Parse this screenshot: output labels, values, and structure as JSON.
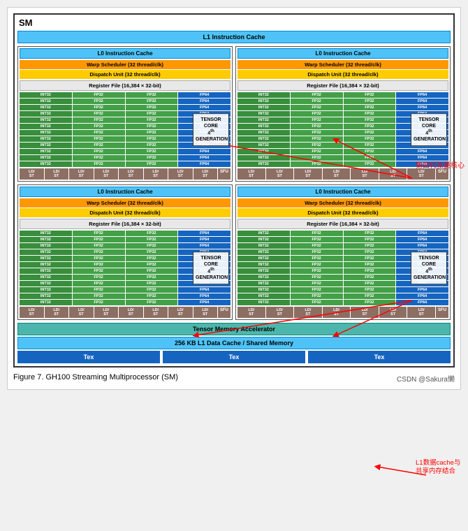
{
  "sm_title": "SM",
  "l1_instruction_cache": "L1 Instruction Cache",
  "quadrants": [
    {
      "l0": "L0 Instruction Cache",
      "warp": "Warp Scheduler (32 thread/clk)",
      "dispatch": "Dispatch Unit (32 thread/clk)",
      "register": "Register File (16,384 × 32-bit)",
      "tensor_label": "TENSOR CORE\n4th GENERATION"
    },
    {
      "l0": "L0 Instruction Cache",
      "warp": "Warp Scheduler (32 thread/clk)",
      "dispatch": "Dispatch Unit (32 thread/clk)",
      "register": "Register File (16,384 × 32-bit)",
      "tensor_label": "TENSOR CORE\n4th GENERATION"
    },
    {
      "l0": "L0 Instruction Cache",
      "warp": "Warp Scheduler (32 thread/clk)",
      "dispatch": "Dispatch Unit (32 thread/clk)",
      "register": "Register File (16,384 × 32-bit)",
      "tensor_label": "TENSOR CORE\n4th GENERATION"
    },
    {
      "l0": "L0 Instruction Cache",
      "warp": "Warp Scheduler (32 thread/clk)",
      "dispatch": "Dispatch Unit (32 thread/clk)",
      "register": "Register File (16,384 × 32-bit)",
      "tensor_label": "TENSOR CORE\n4th GENERATION"
    }
  ],
  "core_rows": [
    {
      "int32": "INT32",
      "fp32a": "FP32",
      "fp32b": "FP32",
      "fp64": "FP64"
    },
    {
      "int32": "INT32",
      "fp32a": "FP32",
      "fp32b": "FP32",
      "fp64": "FP64"
    },
    {
      "int32": "INT32",
      "fp32a": "FP32",
      "fp32b": "FP32",
      "fp64": "FP64"
    },
    {
      "int32": "INT32",
      "fp32a": "FP32",
      "fp32b": "FP32",
      "fp64": "FP64"
    },
    {
      "int32": "INT32",
      "fp32a": "FP32",
      "fp32b": "FP32",
      "fp64": "FP64"
    },
    {
      "int32": "INT32",
      "fp32a": "FP32",
      "fp32b": "FP32",
      "fp64": "FP64"
    },
    {
      "int32": "INT32",
      "fp32a": "FP32",
      "fp32b": "FP32",
      "fp64": "FP64"
    },
    {
      "int32": "INT32",
      "fp32a": "FP32",
      "fp32b": "FP32",
      "fp64": "FP64"
    },
    {
      "int32": "INT32",
      "fp32a": "FP32",
      "fp32b": "FP32",
      "fp64": "FP64"
    },
    {
      "int32": "INT32",
      "fp32a": "FP32",
      "fp32b": "FP32",
      "fp64": "FP64"
    },
    {
      "int32": "INT32",
      "fp32a": "FP32",
      "fp32b": "FP32",
      "fp64": "FP64"
    },
    {
      "int32": "INT32",
      "fp32a": "FP32",
      "fp32b": "FP32",
      "fp64": "FP64"
    }
  ],
  "ld_st_label": "LD/ST",
  "sfu_label": "SFU",
  "tensor_memory_accelerator": "Tensor Memory Accelerator",
  "l1_data_cache": "256 KB L1 Data Cache / Shared Memory",
  "tex_label": "Tex",
  "figure_caption": "Figure 7.    GH100 Streaming Multiprocessor (SM)",
  "attribution": "CSDN @Sakura懒",
  "annotation1": "第四代张量核心",
  "annotation2": "L1数据cache与\n共享内存结合"
}
